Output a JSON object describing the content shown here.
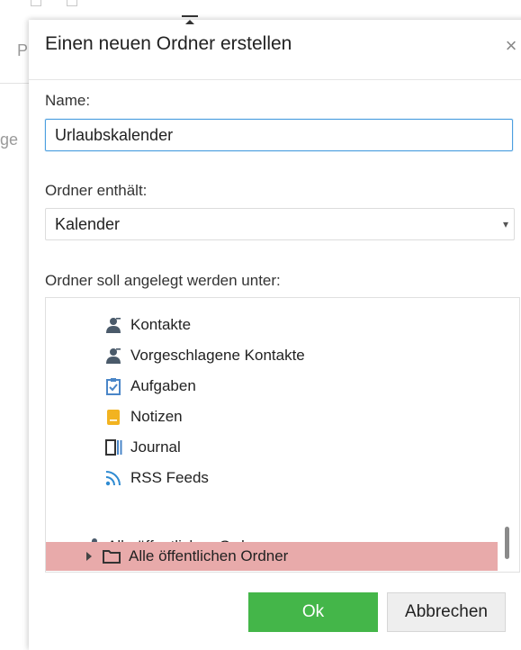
{
  "background": {
    "fragment_top": "P",
    "fragment_mid": "ge"
  },
  "dialog": {
    "title": "Einen neuen Ordner erstellen",
    "close_icon": "×",
    "name_label": "Name:",
    "name_value": "Urlaubskalender",
    "contains_label": "Ordner enthält:",
    "contains_value": "Kalender",
    "location_label": "Ordner soll angelegt werden unter:",
    "tree": {
      "items": [
        {
          "label": "Kontakte",
          "icon": "contacts-icon"
        },
        {
          "label": "Vorgeschlagene Kontakte",
          "icon": "contacts-icon"
        },
        {
          "label": "Aufgaben",
          "icon": "tasks-icon"
        },
        {
          "label": "Notizen",
          "icon": "notes-icon"
        },
        {
          "label": "Journal",
          "icon": "journal-icon"
        },
        {
          "label": "RSS Feeds",
          "icon": "rss-icon"
        }
      ],
      "public_root": {
        "label": "Alle öffentlichen Ordner",
        "icon": "share-icon",
        "expanded": true
      },
      "public_child": {
        "label": "Alle öffentlichen Ordner",
        "icon": "folder-icon",
        "selected": true
      }
    },
    "ok_label": "Ok",
    "cancel_label": "Abbrechen"
  },
  "colors": {
    "ok_button": "#44b649",
    "selected_row": "#e8aaaa",
    "input_focus_border": "#4d9fe0",
    "contacts_icon": "#4a5a6a",
    "tasks_icon": "#4a86c8",
    "notes_icon": "#f2b320",
    "rss_icon": "#2f8bd2"
  }
}
